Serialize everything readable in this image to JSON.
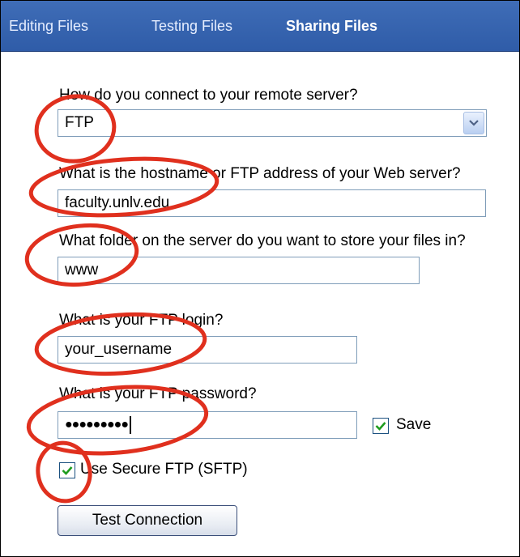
{
  "tabs": [
    {
      "label": "Editing Files",
      "active": false
    },
    {
      "label": "Testing Files",
      "active": false
    },
    {
      "label": "Sharing Files",
      "active": true
    }
  ],
  "form": {
    "connection": {
      "label": "How do you connect to your remote server?",
      "value": "FTP"
    },
    "hostname": {
      "label": "What is the hostname or FTP address of your Web server?",
      "value": "faculty.unlv.edu"
    },
    "folder": {
      "label": "What folder on the server do you want to store your files in?",
      "value": "www"
    },
    "login": {
      "label": "What is your FTP login?",
      "value": "your_username"
    },
    "password": {
      "label": "What is your FTP password?",
      "value": "●●●●●●●●●"
    },
    "save": {
      "label": "Save",
      "checked": true
    },
    "sftp": {
      "label": "Use Secure FTP (SFTP)",
      "checked": true
    },
    "test_button": "Test Connection"
  },
  "colors": {
    "tabbar": "#3465b0",
    "annotation": "#e0301e",
    "check": "#1e9c1e"
  },
  "icons": {
    "dropdown": "chevron-down-icon",
    "checkmark": "checkmark-icon"
  }
}
